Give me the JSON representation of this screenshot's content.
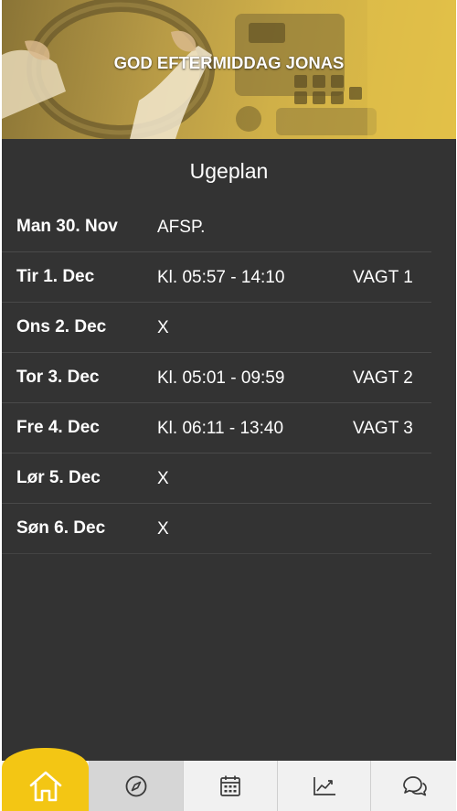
{
  "header": {
    "greeting": "GOD EFTERMIDDAG JONAS"
  },
  "plan": {
    "title": "Ugeplan",
    "days": [
      {
        "day": "Man 30. Nov",
        "time": "AFSP.",
        "shift": ""
      },
      {
        "day": "Tir 1. Dec",
        "time": "Kl. 05:57 - 14:10",
        "shift": "VAGT 1"
      },
      {
        "day": "Ons 2. Dec",
        "time": "X",
        "shift": ""
      },
      {
        "day": "Tor 3. Dec",
        "time": "Kl. 05:01 - 09:59",
        "shift": "VAGT 2"
      },
      {
        "day": "Fre 4. Dec",
        "time": "Kl. 06:11 - 13:40",
        "shift": "VAGT 3"
      },
      {
        "day": "Lør 5. Dec",
        "time": "X",
        "shift": ""
      },
      {
        "day": "Søn 6. Dec",
        "time": "X",
        "shift": ""
      }
    ]
  },
  "nav": {
    "items": [
      {
        "icon": "home-icon",
        "active": true
      },
      {
        "icon": "compass-icon",
        "active": false
      },
      {
        "icon": "calendar-icon",
        "active": false
      },
      {
        "icon": "chart-icon",
        "active": false
      },
      {
        "icon": "chat-icon",
        "active": false
      }
    ]
  },
  "colors": {
    "background": "#333333",
    "accent": "#f3c614",
    "nav_background": "#f1f1f1",
    "text": "#ffffff"
  }
}
